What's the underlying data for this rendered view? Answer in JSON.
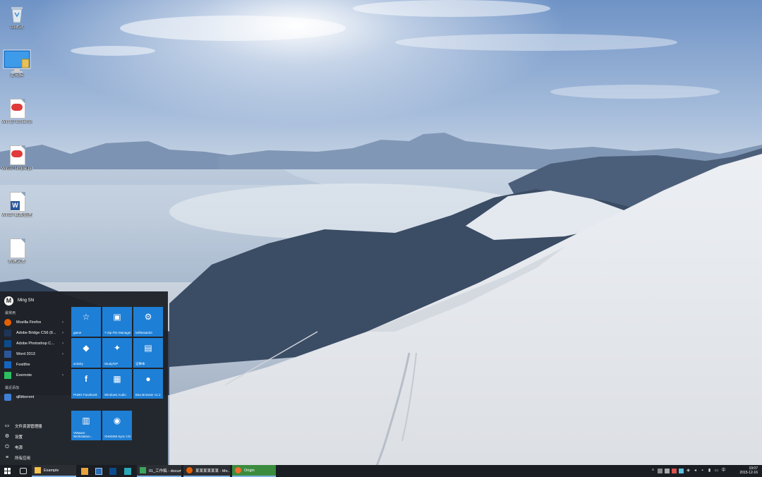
{
  "desktop": {
    "icons": [
      {
        "label": "回收站",
        "icon": "recycle-bin-icon"
      },
      {
        "label": "此电脑",
        "icon": "computer-icon"
      },
      {
        "label": "Win 10 screensh...",
        "icon": "pdf-file-icon"
      },
      {
        "label": "Win10 simple.pdf",
        "icon": "pdf-file-icon"
      },
      {
        "label": "Win10 截图整理.docx",
        "icon": "word-file-icon"
      },
      {
        "label": "新建文本",
        "icon": "text-file-icon"
      }
    ]
  },
  "start_menu": {
    "user": {
      "initial": "M",
      "name": "Ming Shi"
    },
    "most_used_title": "最常用",
    "most_used": [
      {
        "label": "Mozilla Firefox",
        "color": "#e66000"
      },
      {
        "label": "Adobe Bridge CS6 (6...",
        "color": "#1d3557"
      },
      {
        "label": "Adobe Photoshop C...",
        "color": "#0b4b8c"
      },
      {
        "label": "Word 2013",
        "color": "#2b579a"
      },
      {
        "label": "Foxitfire",
        "color": "#1565c0"
      },
      {
        "label": "Evernote",
        "color": "#2dbe60"
      }
    ],
    "recent_title": "最近添加",
    "recent": [
      {
        "label": "qBittorrent",
        "color": "#3f7fd6"
      }
    ],
    "system": [
      {
        "label": "文件资源管理器",
        "icon": "folder-icon"
      },
      {
        "label": "设置",
        "icon": "gear-icon"
      },
      {
        "label": "电源",
        "icon": "power-icon"
      },
      {
        "label": "所有应用",
        "icon": "list-icon"
      }
    ],
    "tiles": [
      {
        "label": "game",
        "glyph": "☆"
      },
      {
        "label": "7-Zip File Manager",
        "glyph": "▣"
      },
      {
        "label": "lolifiesta033",
        "glyph": "⚙"
      },
      {
        "label": "activity",
        "glyph": "◆"
      },
      {
        "label": "Study/GP",
        "glyph": "✦"
      },
      {
        "label": "记事本",
        "glyph": "▤"
      },
      {
        "label": "PUBG Facebook",
        "glyph": "f"
      },
      {
        "label": "Windows Audio",
        "glyph": "▦"
      },
      {
        "label": "Bau Browser v1.2",
        "glyph": "●"
      },
      {
        "label": "VMware Workstation...",
        "glyph": "▥"
      },
      {
        "label": "XHMS58 Sync CN",
        "glyph": "◉"
      }
    ]
  },
  "taskbar": {
    "start_icon": "windows-start-icon",
    "task_view_icon": "task-view-icon",
    "apps": [
      {
        "label": "Example",
        "color": "#f2c14e"
      },
      {
        "label": "01_工作稿 - docum...",
        "color": "#3ba55c"
      },
      {
        "label": "某某某某某某 - Mo...",
        "color": "#e66000"
      },
      {
        "label": "Origin",
        "color": "#f56c2d"
      }
    ],
    "clock": {
      "time": "19:07",
      "date": "2015-12-16"
    }
  },
  "colors": {
    "tile": "#1e7fd6",
    "start_menu_bg": "#1e2228",
    "taskbar_bg": "#1a1d22"
  }
}
